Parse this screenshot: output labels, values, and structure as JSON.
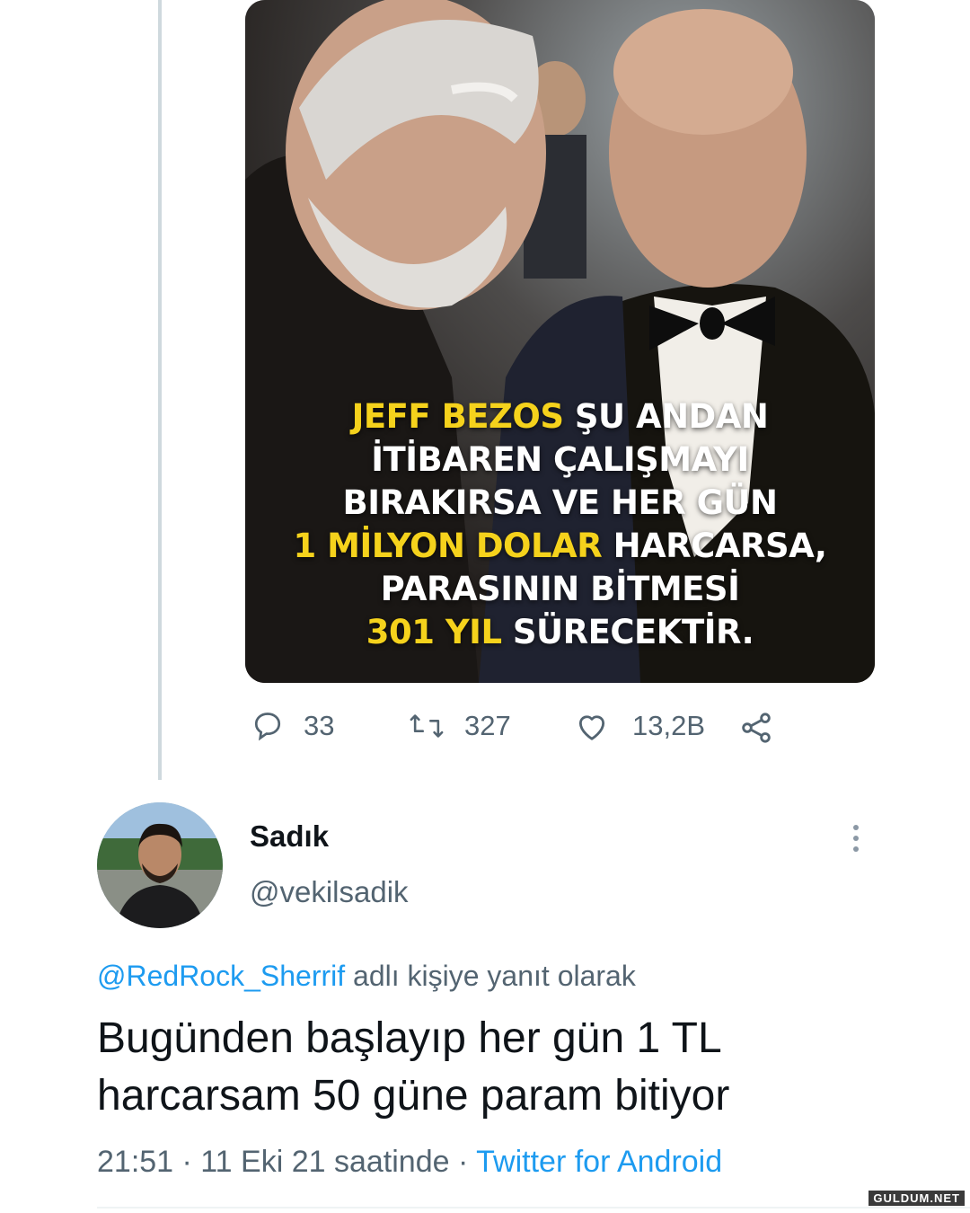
{
  "media": {
    "overlay_lines": [
      [
        {
          "t": "JEFF BEZOS",
          "hl": true
        },
        {
          "t": " ŞU ANDAN",
          "hl": false
        }
      ],
      [
        {
          "t": "İTİBAREN ÇALIŞMAYI",
          "hl": false
        }
      ],
      [
        {
          "t": "BIRAKIRSA VE HER GÜN",
          "hl": false
        }
      ],
      [
        {
          "t": "1 MİLYON DOLAR",
          "hl": true
        },
        {
          "t": " HARCARSA,",
          "hl": false
        }
      ],
      [
        {
          "t": "PARASININ BİTMESİ",
          "hl": false
        }
      ],
      [
        {
          "t": "301 YIL",
          "hl": true
        },
        {
          "t": " SÜRECEKTİR.",
          "hl": false
        }
      ]
    ]
  },
  "actions": {
    "replies": "33",
    "retweets": "327",
    "likes": "13,2B",
    "icons": [
      "reply-icon",
      "retweet-icon",
      "like-icon",
      "share-icon"
    ]
  },
  "reply": {
    "name": "Sadık",
    "handle": "@vekilsadik",
    "reply_to_mention": "@RedRock_Sherrif",
    "reply_to_suffix": " adlı kişiye yanıt olarak",
    "text_line1": "Bugünden başlayıp her gün 1 TL",
    "text_line2": "harcarsam 50 güne param bitiyor",
    "timestamp": "21:51 · 11 Eki 21 saatinde · ",
    "source": "Twitter for Android"
  },
  "watermark": "GULDUM.NET",
  "colors": {
    "accent": "#1d9bf0",
    "muted": "#536471",
    "highlight": "#f5d21c"
  }
}
